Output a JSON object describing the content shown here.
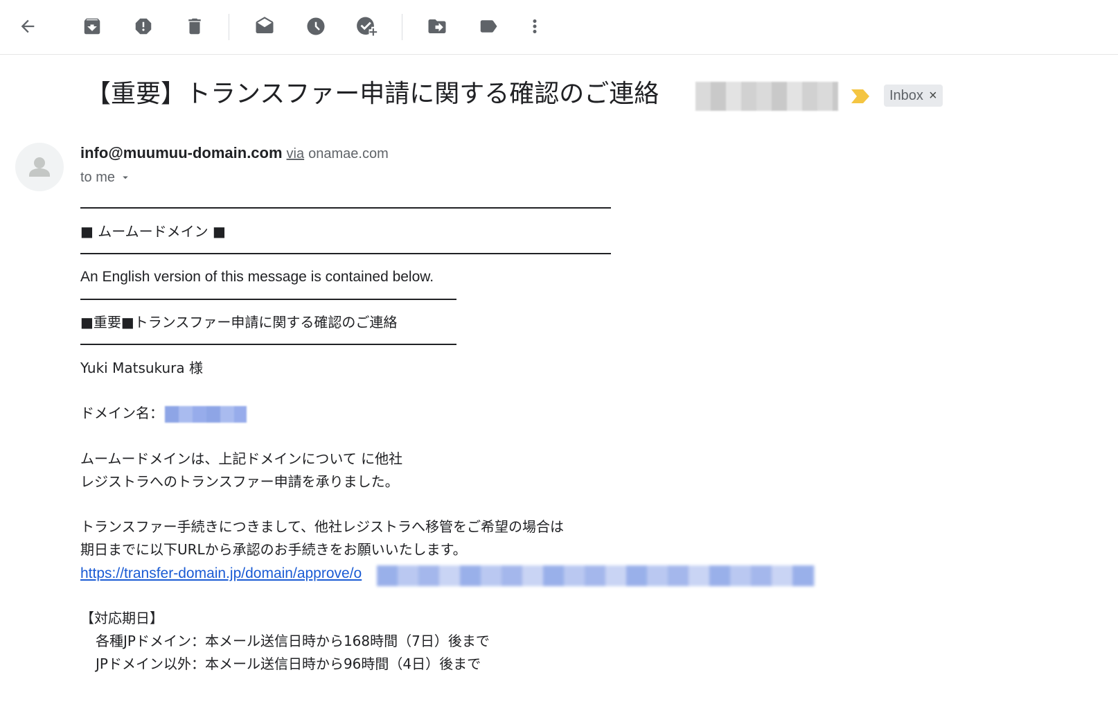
{
  "toolbar": {
    "buttons": [
      {
        "name": "back-button",
        "icon": "arrow-back-icon"
      },
      {
        "name": "archive-button",
        "icon": "archive-icon"
      },
      {
        "name": "report-spam-button",
        "icon": "report-spam-icon"
      },
      {
        "name": "delete-button",
        "icon": "trash-icon"
      },
      {
        "name": "mark-unread-button",
        "icon": "mark-unread-icon"
      },
      {
        "name": "snooze-button",
        "icon": "clock-icon"
      },
      {
        "name": "add-to-tasks-button",
        "icon": "add-task-icon"
      },
      {
        "name": "move-to-button",
        "icon": "move-to-icon"
      },
      {
        "name": "labels-button",
        "icon": "label-icon"
      },
      {
        "name": "more-button",
        "icon": "more-vert-icon"
      }
    ]
  },
  "email": {
    "subject": "【重要】トランスファー申請に関する確認のご連絡",
    "label_chip": "Inbox",
    "label_chip_close": "×",
    "sender": {
      "email": "info@muumuu-domain.com",
      "via_label": "via",
      "via_domain": "onamae.com",
      "recipient_label": "to me"
    },
    "body": {
      "brand_line": "■ ムームードメイン ■",
      "english_notice": "An English version of this message is contained below.",
      "heading": "■重要■トランスファー申請に関する確認のご連絡",
      "greeting": "Yuki Matsukura 様",
      "domain_label": "ドメイン名：",
      "paragraph1_line1": "ムームードメインは、上記ドメインについて に他社",
      "paragraph1_line2": "レジストラへのトランスファー申請を承りました。",
      "paragraph2_line1": "トランスファー手続きにつきまして、他社レジストラへ移管をご希望の場合は",
      "paragraph2_line2": "期日までに以下URLから承認のお手続きをお願いいたします。",
      "approve_url": "https://transfer-domain.jp/domain/approve/o",
      "deadline_heading": "【対応期日】",
      "deadline_jp": "各種JPドメイン：本メール送信日時から168時間（7日）後まで",
      "deadline_non_jp": "JPドメイン以外：本メール送信日時から96時間（4日）後まで"
    }
  },
  "colors": {
    "importance_marker": "#f4c542",
    "link": "#1a5bd4",
    "chip_bg": "#e8eaed",
    "icon": "#5f6368"
  }
}
